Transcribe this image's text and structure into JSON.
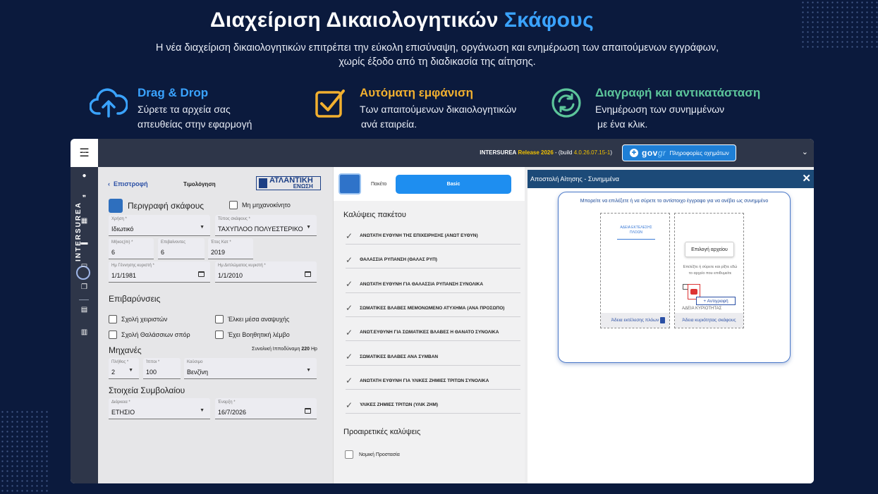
{
  "hero": {
    "title": "Διαχείριση Δικαιολογητικών",
    "title_accent": "Σκάφους",
    "subtitle_line1": "Η νέα διαχείριση δικαιολογητικών επιτρέπει την εύκολη επισύναψη, οργάνωση και ενημέρωση των απαιτούμενων εγγράφων,",
    "subtitle_line2": "χωρίς έξοδο από τη διαδικασία της αίτησης."
  },
  "features": [
    {
      "title": "Drag & Drop",
      "line1": "Σύρετε τα αρχεία σας",
      "line2": "απευθείας στην εφαρμογή",
      "color": "#3aa3ff",
      "icon": "cloud-upload-icon"
    },
    {
      "title": "Αυτόματη εμφάνιση",
      "line1": "Των απαιτούμενων δικαιολογητικών",
      "line2": "ανά εταιρεία.",
      "color": "#f2b02f",
      "icon": "checkbox-icon"
    },
    {
      "title": "Διαγραφή και αντικατάσταση",
      "line1": "Ενημέρωση των συνημμένων",
      "line2": "με ένα κλικ.",
      "color": "#5cc59a",
      "icon": "refresh-icon"
    }
  ],
  "topbar": {
    "build_brand": "INTERSUREA",
    "build_release": "Release 2026",
    "build_prefix": " - (build ",
    "build_version": "4.0.26.07.15-1",
    "build_suffix": ")",
    "gov_logo": "gov",
    "gov_logo_suffix": "gr",
    "gov_label": "Πληροφορίες οχημάτων"
  },
  "sidebar": {
    "brand": "INTERSUREA",
    "icons": [
      "home-icon",
      "user-icon",
      "quote-icon",
      "grid-icon",
      "briefcase-icon",
      "store-icon",
      "copy-icon",
      "file-icon",
      "database-icon"
    ],
    "glyphs": [
      "⌂",
      "●",
      "❞",
      "▦",
      "▬",
      "▭",
      "❐",
      "▤",
      "▥"
    ]
  },
  "form": {
    "back_label": "Επιστροφή",
    "tab_label": "Τιμολόγηση",
    "insurer_name": "ΑΤΛΑΝΤΙΚΗ",
    "insurer_sub": "ΕΝΩΣΗ",
    "vessel_title": "Περιγραφή σκάφους",
    "non_motor_label": "Μη μηχανοκίνητο",
    "fields": {
      "usage": {
        "label": "Χρήση *",
        "value": "Ιδιωτικό"
      },
      "vessel_type": {
        "label": "Τύπος σκάφους *",
        "value": "ΤΑΧΥΠΛΟΟ ΠΟΛΥΕΣΤΕΡΙΚΟ"
      },
      "length": {
        "label": "Μήκος(m) *",
        "value": "6"
      },
      "passengers": {
        "label": "Επιβαίνοντες",
        "value": "6"
      },
      "year": {
        "label": "Έτος Κατ *",
        "value": "2019"
      },
      "owner_birth": {
        "label": "Ημ Γέννησης κυριστή *",
        "value": "1/1/1981"
      },
      "license_date": {
        "label": "Ημ Διπλώματος κυριστή *",
        "value": "1/1/2010"
      },
      "engine_count": {
        "label": "Πλήθος *",
        "value": "2"
      },
      "hp": {
        "label": "Ίπποι *",
        "value": "100"
      },
      "fuel": {
        "label": "Καύσιμο",
        "value": "Βενζίνη"
      },
      "duration": {
        "label": "Διάρκεια *",
        "value": "ΕΤΗΣΙΟ"
      },
      "start_date": {
        "label": "Έναρξη *",
        "value": "16/7/2026"
      }
    },
    "surcharges_title": "Επιβαρύνσεις",
    "surcharges": [
      "Σχολή χειριστών",
      "Έλκει μέσα αναψυχής",
      "Σχολή Θαλάσσιων σπόρ",
      "Έχει Βοηθητική λέμβο"
    ],
    "engines_title": "Μηχανές",
    "total_power_label": "Συνολική Ιπποδύναμη",
    "total_power_value": "220",
    "total_power_unit": "Hp",
    "contract_title": "Στοιχεία Συμβολαίου"
  },
  "package": {
    "label": "Πακέτο",
    "selected": "Basic",
    "coverages_title": "Καλύψεις πακέτου",
    "coverages": [
      "ΑΝΩΤΑΤΗ ΕΥΘΥΝΗ ΤΗΣ ΕΠΙΧΕΙΡΗΣΗΣ (ΑΝΩΤ ΕΥΘΥΝ)",
      "ΘΑΛΑΣΣΙΑ ΡΥΠΑΝΣΗ (ΘΑΛΑΣ ΡΥΠ)",
      "ΑΝΩΤΑΤΗ ΕΥΘΥΝΗ ΓΙΑ ΘΑΛΑΣΣΙΑ ΡΥΠΑΝΣΗ ΣΥΝΟΛΙΚΑ",
      "ΣΩΜΑΤΙΚΕΣ ΒΛΑΒΕΣ ΜΕΜΟΝΩΜΕΝΟ ΑΤΥΧΗΜΑ (ΑΝΑ ΠΡΟΣΩΠΟ)",
      "ΑΝΩΤ.ΕΥΘΥΝΗ ΓΙΑ ΣΩΜΑΤΙΚΕΣ ΒΛΑΒΕΣ Η ΘΑΝΑΤΟ ΣΥΝΟΛΙΚΑ",
      "ΣΩΜΑΤΙΚΕΣ ΒΛΑΒΕΣ ΑΝΑ ΣΥΜΒΑΝ",
      "ΑΝΩΤΑΤΗ ΕΥΘΥΝΗ ΓΙΑ ΥΛΙΚΕΣ ΖΗΜΙΕΣ ΤΡΙΤΩΝ ΣΥΝΟΛΙΚΑ",
      "ΥΛΙΚΕΣ ΖΗΜΙΕΣ ΤΡΙΤΩΝ (ΥΛΙΚ ΖΗΜ)"
    ],
    "optional_title": "Προαιρετικές καλύψεις",
    "optional": [
      "Νομική Προστασία"
    ]
  },
  "modal": {
    "title": "Αποστολή Αίτησης - Συνημμένα",
    "hint": "Μπορείτε να επιλέξετε ή να σύρετε το αντίστοιχο έγγραφο για να ανέβει ως συνημμένο",
    "card1": {
      "doc_name": "ΑΔΕΙΑ ΕΚΤΕΛΕΣΗΣ ΠΛΟΩΝ",
      "footer": "Άδεια εκτέλεσης πλόων"
    },
    "card2": {
      "button": "Επιλογή αρχείου",
      "drag_hint": "Επιλέξτε ή σύρετε και ρίξτε εδώ το αρχείο που επιθυμείτε",
      "copy_tip": "+ Αντιγραφή",
      "ghost_file": "ΑΔΕΙΑ ΚΥΡΙΟΤΗΤΑΣ",
      "footer": "Άδεια κυριότητας σκάφους"
    }
  }
}
